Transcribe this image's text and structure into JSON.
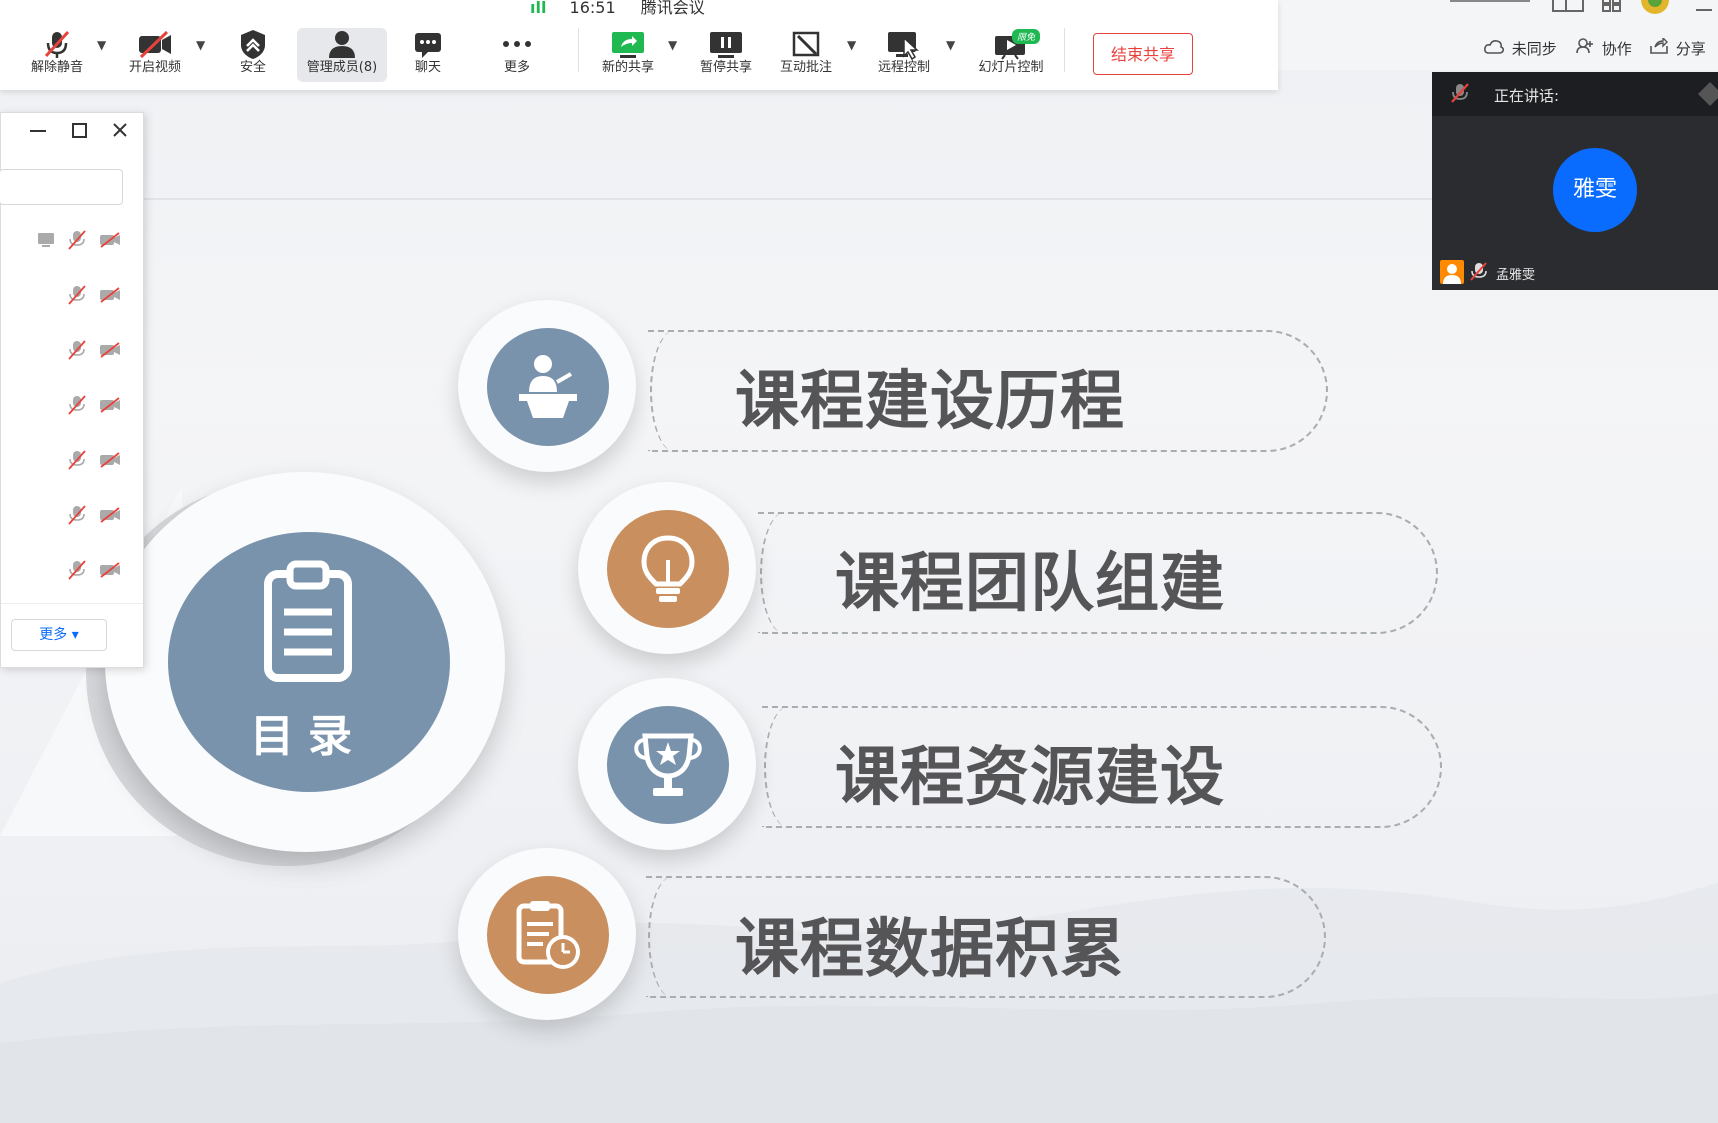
{
  "window": {
    "signal": "ıll",
    "time": "16:51",
    "app_name": "腾讯会议"
  },
  "toolbar": {
    "unmute": "解除静音",
    "start_video": "开启视频",
    "security": "安全",
    "manage_members": "管理成员(8)",
    "chat": "聊天",
    "more": "更多",
    "new_share": "新的共享",
    "pause_share": "暂停共享",
    "annotate": "互动批注",
    "remote_control": "远程控制",
    "slide_control": "幻灯片控制",
    "free_badge": "限免",
    "end_share": "结束共享"
  },
  "right_bar": {
    "not_synced": "未同步",
    "collaborate": "协作",
    "share": "分享"
  },
  "speaker": {
    "title": "正在讲话:",
    "avatar_text": "雅雯",
    "name": "孟雅雯"
  },
  "members_panel": {
    "more_button": "更多 ▾",
    "row_count": 7
  },
  "slide": {
    "catalog_label": "目录",
    "items": [
      {
        "text": "课程建设历程",
        "icon": "lecturer-podium-icon",
        "color": "#7a93ad"
      },
      {
        "text": "课程团队组建",
        "icon": "lightbulb-icon",
        "color": "#c98f5e"
      },
      {
        "text": "课程资源建设",
        "icon": "trophy-icon",
        "color": "#7a93ad"
      },
      {
        "text": "课程数据积累",
        "icon": "clipboard-timer-icon",
        "color": "#c98f5e"
      }
    ]
  }
}
